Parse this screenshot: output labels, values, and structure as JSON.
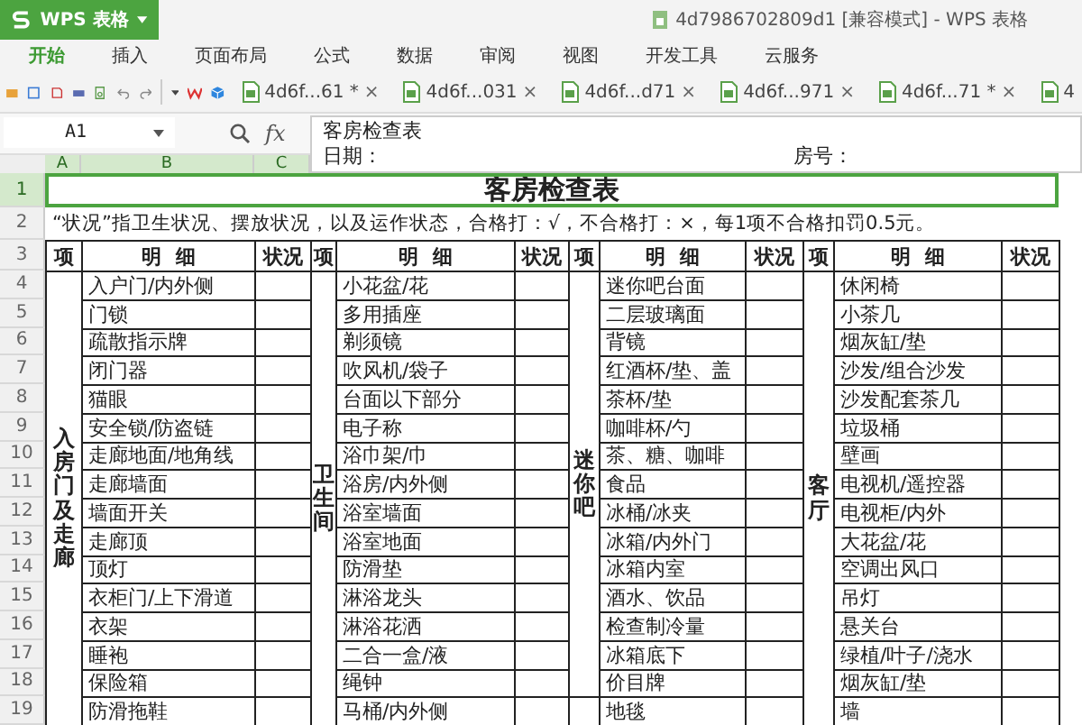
{
  "app": {
    "name": "WPS 表格",
    "title": "4d7986702809d1 [兼容模式] - WPS 表格"
  },
  "menu": [
    {
      "label": "开始",
      "selected": true
    },
    {
      "label": "插入",
      "selected": false
    },
    {
      "label": "页面布局",
      "selected": false
    },
    {
      "label": "公式",
      "selected": false
    },
    {
      "label": "数据",
      "selected": false
    },
    {
      "label": "审阅",
      "selected": false
    },
    {
      "label": "视图",
      "selected": false
    },
    {
      "label": "开发工具",
      "selected": false
    },
    {
      "label": "云服务",
      "selected": false
    }
  ],
  "doc_tabs": [
    {
      "label": "4d6f...61 *",
      "close": "×"
    },
    {
      "label": "4d6f...031",
      "close": "×"
    },
    {
      "label": "4d6f...d71",
      "close": "×"
    },
    {
      "label": "4d6f...971",
      "close": "×"
    },
    {
      "label": "4d6f...71 *",
      "close": "×"
    },
    {
      "label": "4"
    }
  ],
  "formula_bar": {
    "name_box": "A1",
    "fx": "fx",
    "line1": "客房检查表",
    "line2_left": "日期：",
    "line2_right": "房号："
  },
  "column_headers": [
    {
      "label": "A",
      "selected": true
    },
    {
      "label": "B",
      "selected": true
    },
    {
      "label": "C",
      "selected": true
    }
  ],
  "row_headers": [
    {
      "label": "1",
      "selected": true
    },
    {
      "label": "2",
      "selected": false
    },
    {
      "label": "3",
      "selected": false
    },
    {
      "label": "4",
      "selected": false
    },
    {
      "label": "5",
      "selected": false
    },
    {
      "label": "6",
      "selected": false
    },
    {
      "label": "7",
      "selected": false
    },
    {
      "label": "8",
      "selected": false
    },
    {
      "label": "9",
      "selected": false
    },
    {
      "label": "10",
      "selected": false
    },
    {
      "label": "11",
      "selected": false
    },
    {
      "label": "12",
      "selected": false
    },
    {
      "label": "13",
      "selected": false
    },
    {
      "label": "14",
      "selected": false
    },
    {
      "label": "15",
      "selected": false
    },
    {
      "label": "16",
      "selected": false
    },
    {
      "label": "17",
      "selected": false
    },
    {
      "label": "18",
      "selected": false
    },
    {
      "label": "19",
      "selected": false
    }
  ],
  "sheet": {
    "title": "客房检查表",
    "title_selected": true,
    "note": "“状况”指卫生状况、摆放状况，以及运作状态，合格打：√，不合格打：×，每1项不合格扣罚0.5元。",
    "groups": [
      {
        "headers": [
          "项",
          "明  细",
          "状况"
        ],
        "sections": [
          {
            "label": "入房门及走廊",
            "items": [
              "入户门/内外侧",
              "门锁",
              "疏散指示牌",
              "闭门器",
              "猫眼",
              "安全锁/防盗链",
              "走廊地面/地角线",
              "走廊墙面",
              "墙面开关",
              "走廊顶",
              "顶灯",
              "衣柜门/上下滑道",
              "衣架",
              "睡袍",
              "保险箱",
              "防滑拖鞋"
            ]
          }
        ]
      },
      {
        "headers": [
          "项",
          "明  细",
          "状况"
        ],
        "sections": [
          {
            "label": "卫生间",
            "items": [
              "小花盆/花",
              "多用插座",
              "剃须镜",
              "吹风机/袋子",
              "台面以下部分",
              "电子称",
              "浴巾架/巾",
              "浴房/内外侧",
              "浴室墙面",
              "浴室地面",
              "防滑垫",
              "淋浴龙头",
              "淋浴花洒",
              "二合一盒/液",
              "绳钟",
              "马桶/内外侧"
            ]
          }
        ]
      },
      {
        "headers": [
          "项",
          "明  细",
          "状况"
        ],
        "sections": [
          {
            "label": "迷你吧",
            "items": [
              "迷你吧台面",
              "二层玻璃面",
              "背镜",
              "红酒杯/垫、盖",
              "茶杯/垫",
              "咖啡杯/勺",
              "茶、糖、咖啡",
              "食品",
              "冰桶/冰夹",
              "冰箱/内外门",
              "冰箱内室",
              "酒水、饮品",
              "检查制冷量",
              "冰箱底下",
              "价目牌"
            ]
          },
          {
            "items": [
              "地毯"
            ]
          }
        ]
      },
      {
        "headers": [
          "项",
          "明  细",
          "状况"
        ],
        "sections": [
          {
            "label": "客厅",
            "items": [
              "休闲椅",
              "小茶几",
              "烟灰缸/垫",
              "沙发/组合沙发",
              "沙发配套茶几",
              "垃圾桶",
              "壁画",
              "电视机/遥控器",
              "电视柜/内外",
              "大花盆/花",
              "空调出风口",
              "吊灯",
              "悬关台",
              "绿植/叶子/浇水",
              "烟灰缸/垫",
              "墙"
            ]
          }
        ]
      }
    ]
  }
}
